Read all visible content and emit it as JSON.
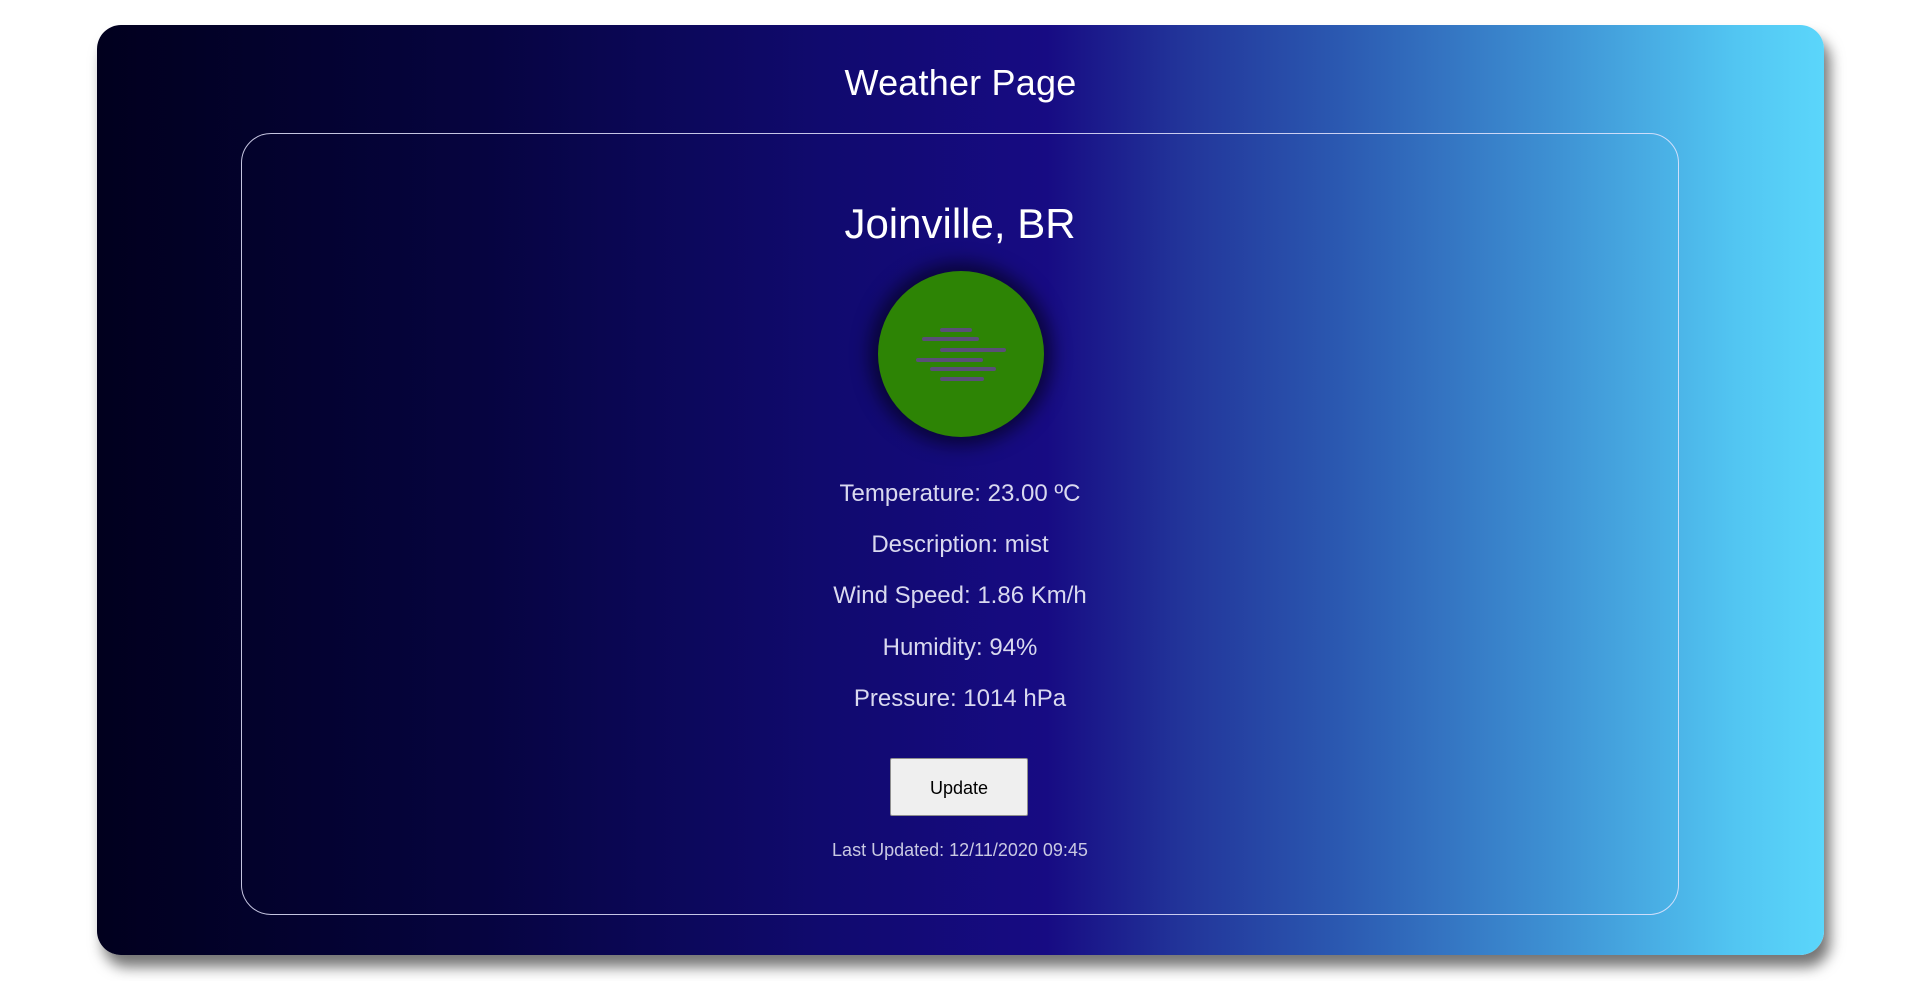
{
  "header": {
    "title": "Weather Page"
  },
  "weather": {
    "city": "Joinville, BR",
    "icon": "mist-icon",
    "temperature": "Temperature: 23.00 ºC",
    "description": "Description: mist",
    "wind_speed": "Wind Speed: 1.86 Km/h",
    "humidity": "Humidity: 94%",
    "pressure": "Pressure: 1014 hPa"
  },
  "actions": {
    "update_label": "Update"
  },
  "status": {
    "last_updated": "Last Updated: 12/11/2020 09:45"
  },
  "colors": {
    "icon_background": "#2d8405",
    "mist_lines": "#5a4f78",
    "gradient_start": "#01001e",
    "gradient_mid": "#170b83",
    "gradient_end": "#5bd6fb"
  }
}
